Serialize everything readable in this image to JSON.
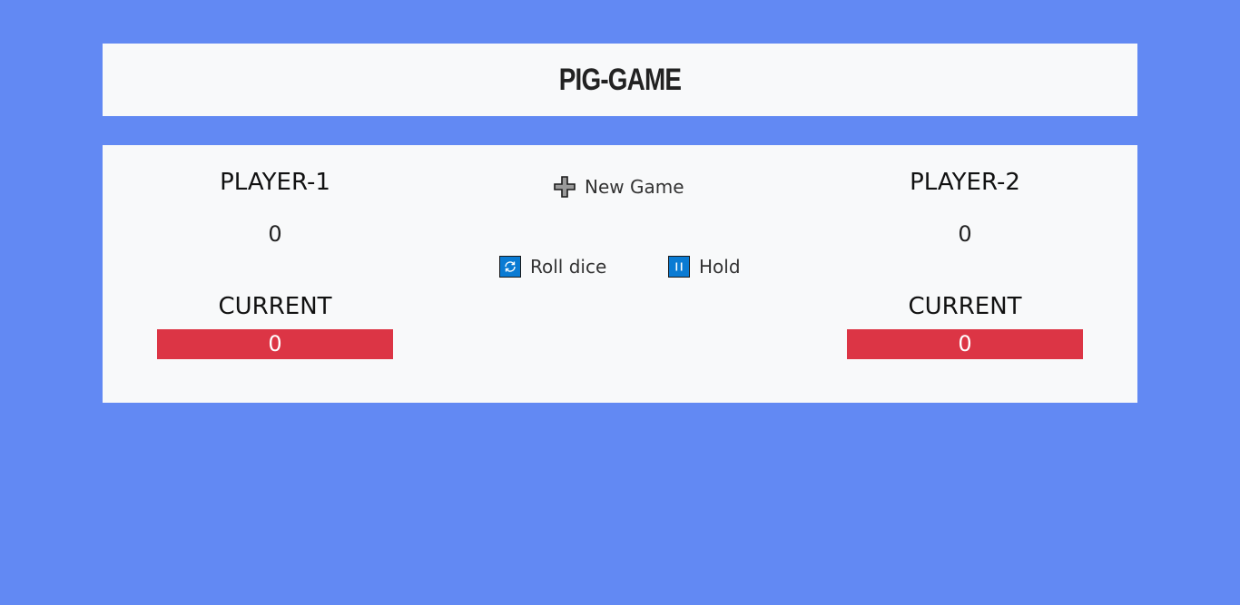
{
  "header": {
    "title": "PIG-GAME"
  },
  "players": [
    {
      "name": "PLAYER-1",
      "score": "0",
      "current_label": "CURRENT",
      "current_score": "0"
    },
    {
      "name": "PLAYER-2",
      "score": "0",
      "current_label": "CURRENT",
      "current_score": "0"
    }
  ],
  "controls": {
    "new_game_label": "New Game",
    "new_game_icon": "plus-icon",
    "roll_label": "Roll dice",
    "roll_icon": "refresh-icon",
    "hold_label": "Hold",
    "hold_icon": "pause-icon"
  },
  "colors": {
    "background": "#6289f3",
    "panel": "#f8f9fa",
    "current_box": "#dc3545",
    "button_icon": "#0a7bd3"
  }
}
